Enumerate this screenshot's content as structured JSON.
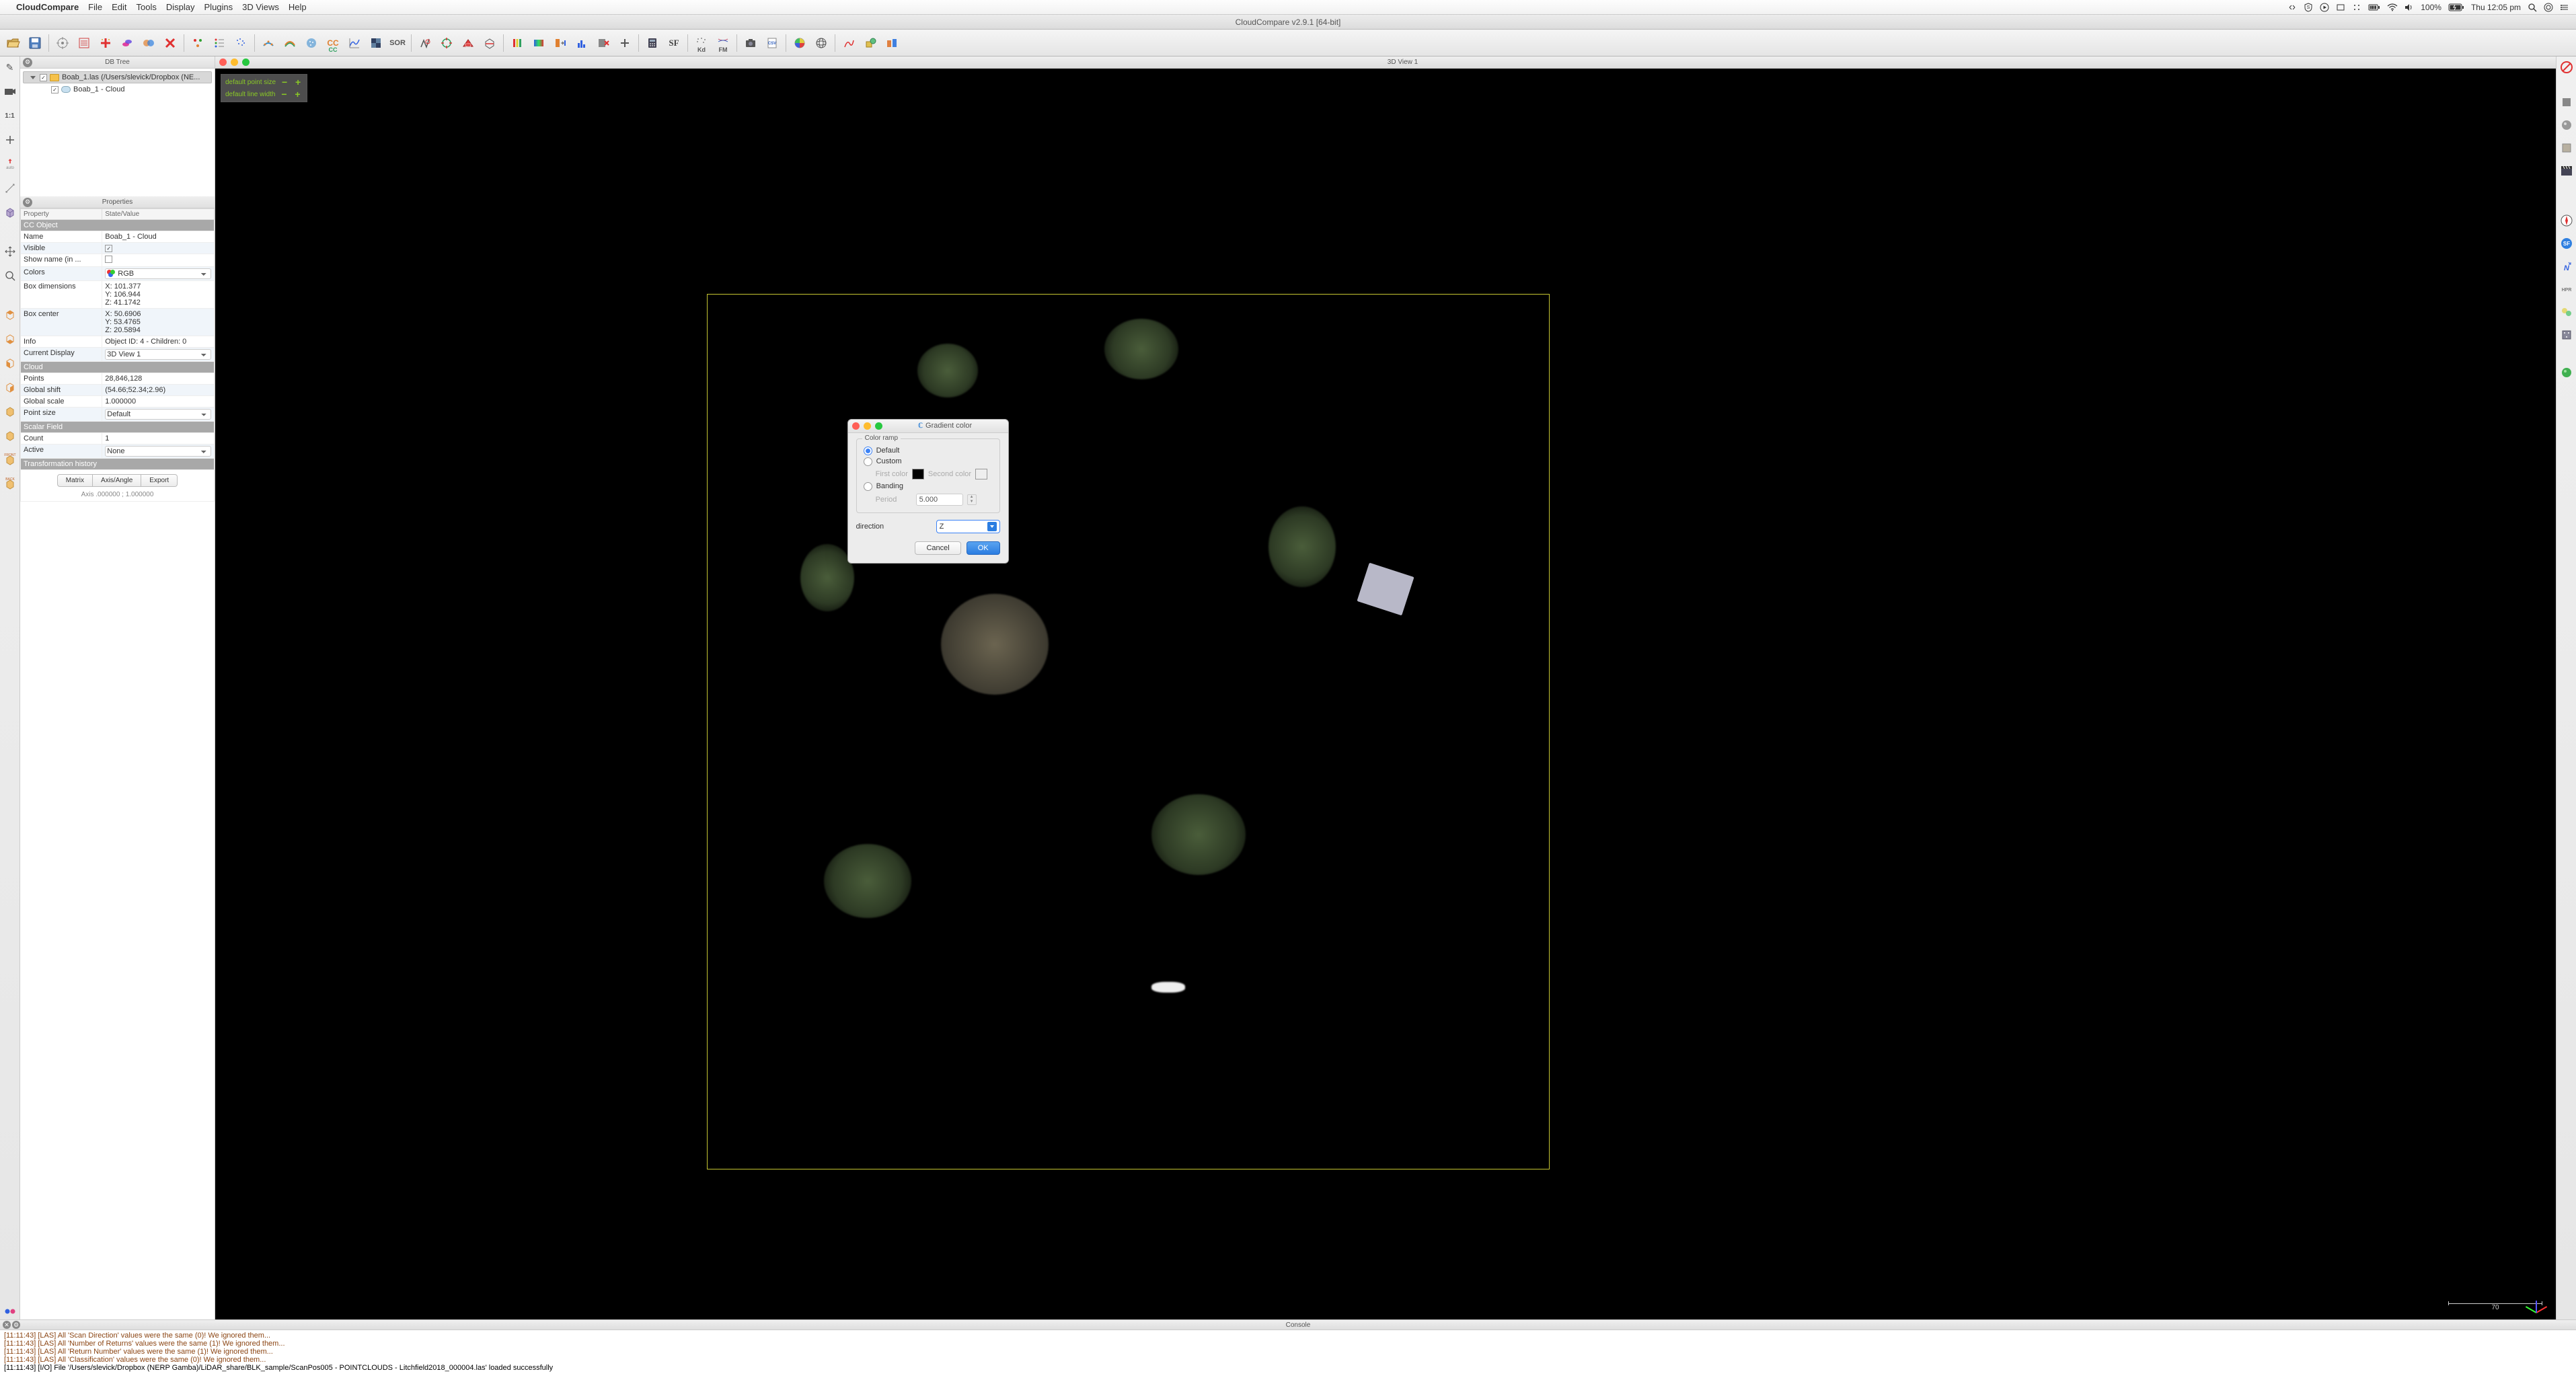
{
  "menubar": {
    "app": "CloudCompare",
    "items": [
      "File",
      "Edit",
      "Tools",
      "Display",
      "Plugins",
      "3D Views",
      "Help"
    ],
    "battery": "100%",
    "clock": "Thu 12:05 pm"
  },
  "window_title": "CloudCompare v2.9.1 [64-bit]",
  "panels": {
    "dbtree_title": "DB Tree",
    "properties_title": "Properties",
    "console_title": "Console"
  },
  "tree": {
    "root": "Boab_1.las (/Users/slevick/Dropbox (NE...",
    "child": "Boab_1 - Cloud"
  },
  "view3d_title": "3D View 1",
  "overlay": {
    "point_size": "default point size",
    "line_width": "default line width"
  },
  "scale_value": "70",
  "properties": {
    "header_prop": "Property",
    "header_val": "State/Value",
    "sections": {
      "ccobj": "CC Object",
      "cloud": "Cloud",
      "sf": "Scalar Field",
      "th": "Transformation history"
    },
    "name_k": "Name",
    "name_v": "Boab_1 - Cloud",
    "visible_k": "Visible",
    "showname_k": "Show name (in ...",
    "colors_k": "Colors",
    "colors_v": "RGB",
    "boxdim_k": "Box dimensions",
    "boxdim_v": "X: 101.377\nY: 106.944\nZ: 41.1742",
    "boxcen_k": "Box center",
    "boxcen_v": "X: 50.6906\nY: 53.4765\nZ: 20.5894",
    "info_k": "Info",
    "info_v": "Object ID: 4 - Children: 0",
    "curdisp_k": "Current Display",
    "curdisp_v": "3D View 1",
    "points_k": "Points",
    "points_v": "28,846,128",
    "gshift_k": "Global shift",
    "gshift_v": "(54.66;52.34;2.96)",
    "gscale_k": "Global scale",
    "gscale_v": "1.000000",
    "psize_k": "Point size",
    "psize_v": "Default",
    "count_k": "Count",
    "count_v": "1",
    "active_k": "Active",
    "active_v": "None",
    "tabs": {
      "matrix": "Matrix",
      "axis": "Axis/Angle",
      "export": "Export"
    },
    "axis_line": "Axis   .000000 ; 1.000000"
  },
  "dialog": {
    "title": "Gradient color",
    "group": "Color ramp",
    "opt_default": "Default",
    "opt_custom": "Custom",
    "first_color": "First color",
    "second_color": "Second color",
    "opt_banding": "Banding",
    "period": "Period",
    "period_val": "5.000",
    "direction": "direction",
    "direction_val": "Z",
    "cancel": "Cancel",
    "ok": "OK"
  },
  "console_lines": [
    {
      "cls": "warn",
      "text": "[11:11:43] [LAS] All 'Scan Direction' values were the same (0)! We ignored them..."
    },
    {
      "cls": "warn",
      "text": "[11:11:43] [LAS] All 'Number of Returns' values were the same (1)! We ignored them..."
    },
    {
      "cls": "warn",
      "text": "[11:11:43] [LAS] All 'Return Number' values were the same (1)! We ignored them..."
    },
    {
      "cls": "warn",
      "text": "[11:11:43] [LAS] All 'Classification' values were the same (0)! We ignored them..."
    },
    {
      "cls": "info",
      "text": "[11:11:43] [I/O] File '/Users/slevick/Dropbox (NERP Gamba)/LiDAR_share/BLK_sample/ScanPos005 - POINTCLOUDS - Litchfield2018_000004.las' loaded successfully"
    }
  ]
}
